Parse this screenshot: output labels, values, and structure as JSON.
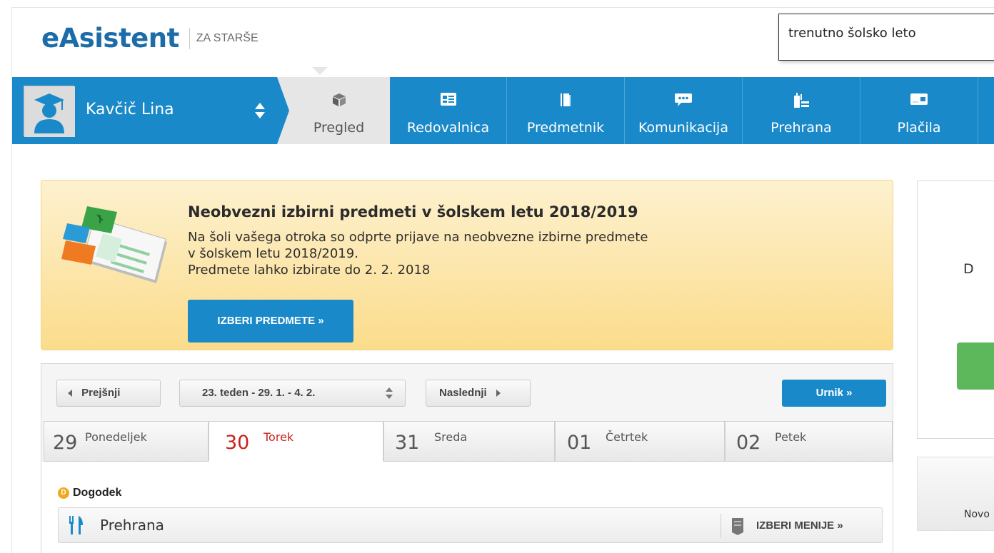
{
  "header": {
    "logo_text": "eAsistent",
    "logo_subtitle": "ZA STARŠE",
    "school_year": "trenutno šolsko leto"
  },
  "user": {
    "name": "Kavčič Lina"
  },
  "nav": {
    "tabs": [
      {
        "label": "Pregled",
        "icon": "cube-icon",
        "active": true
      },
      {
        "label": "Redovalnica",
        "icon": "gradebook-icon",
        "active": false
      },
      {
        "label": "Predmetnik",
        "icon": "book-icon",
        "active": false
      },
      {
        "label": "Komunikacija",
        "icon": "chat-bubble-icon",
        "active": false
      },
      {
        "label": "Prehrana",
        "icon": "food-icon",
        "active": false
      },
      {
        "label": "Plačila",
        "icon": "payment-card-icon",
        "active": false
      }
    ]
  },
  "banner": {
    "title": "Neobvezni izbirni predmeti v šolskem letu 2018/2019",
    "line1": "Na šoli vašega otroka so odprte prijave na neobvezne izbirne predmete",
    "line2": "v šolskem letu 2018/2019.",
    "line3": "Predmete lahko izbirate do 2. 2. 2018",
    "button_label": "IZBERI PREDMETE »"
  },
  "week": {
    "prev_label": "Prejšnji",
    "current_week": "23. teden - 29. 1. - 4. 2.",
    "next_label": "Naslednji",
    "urnik_label": "Urnik »",
    "days": [
      {
        "num": "29",
        "name": "Ponedeljek",
        "active": false
      },
      {
        "num": "30",
        "name": "Torek",
        "active": true
      },
      {
        "num": "31",
        "name": "Sreda",
        "active": false
      },
      {
        "num": "01",
        "name": "Četrtek",
        "active": false
      },
      {
        "num": "02",
        "name": "Petek",
        "active": false
      }
    ],
    "event_badge": "D",
    "event_label": "Dogodek",
    "meal_label": "Prehrana",
    "meal_button": "IZBERI MENIJE »"
  },
  "side": {
    "card_letter": "D",
    "card2_text": "Novo"
  },
  "colors": {
    "brand_blue": "#1a89c9",
    "banner_yellow": "#fbdc8b",
    "active_day_red": "#c9211e"
  }
}
